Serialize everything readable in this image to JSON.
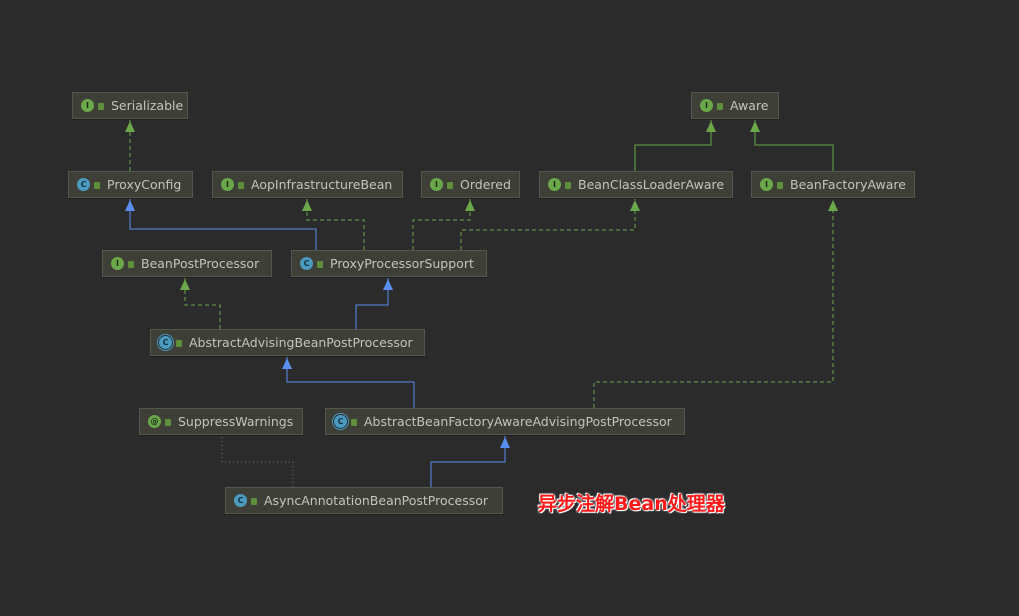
{
  "colors": {
    "background": "#2b2b2b",
    "inheritance": "#5a8ef0",
    "implements": "#6aa84a",
    "annotation": "#777777",
    "annotation_text": "#ff1a1a"
  },
  "nodes": {
    "serializable": {
      "label": "Serializable",
      "kind": "interface"
    },
    "aware": {
      "label": "Aware",
      "kind": "interface"
    },
    "proxy_config": {
      "label": "ProxyConfig",
      "kind": "class"
    },
    "aop_infrastructure_bean": {
      "label": "AopInfrastructureBean",
      "kind": "interface"
    },
    "ordered": {
      "label": "Ordered",
      "kind": "interface"
    },
    "bean_class_loader_aware": {
      "label": "BeanClassLoaderAware",
      "kind": "interface"
    },
    "bean_factory_aware": {
      "label": "BeanFactoryAware",
      "kind": "interface"
    },
    "bean_post_processor": {
      "label": "BeanPostProcessor",
      "kind": "interface"
    },
    "proxy_processor_support": {
      "label": "ProxyProcessorSupport",
      "kind": "class"
    },
    "abstract_advising_bpp": {
      "label": "AbstractAdvisingBeanPostProcessor",
      "kind": "abstract-class"
    },
    "suppress_warnings": {
      "label": "SuppressWarnings",
      "kind": "annotation"
    },
    "abstract_bfa_advising_pp": {
      "label": "AbstractBeanFactoryAwareAdvisingPostProcessor",
      "kind": "abstract-class"
    },
    "async_annotation_bpp": {
      "label": "AsyncAnnotationBeanPostProcessor",
      "kind": "class"
    }
  },
  "icon_letters": {
    "class": "C",
    "interface": "I",
    "annotation": "@"
  },
  "edges": [
    {
      "from": "proxy_config",
      "to": "serializable",
      "type": "implements"
    },
    {
      "from": "bean_class_loader_aware",
      "to": "aware",
      "type": "extends-interface"
    },
    {
      "from": "bean_factory_aware",
      "to": "aware",
      "type": "extends-interface"
    },
    {
      "from": "proxy_processor_support",
      "to": "proxy_config",
      "type": "extends"
    },
    {
      "from": "proxy_processor_support",
      "to": "aop_infrastructure_bean",
      "type": "implements"
    },
    {
      "from": "proxy_processor_support",
      "to": "ordered",
      "type": "implements"
    },
    {
      "from": "proxy_processor_support",
      "to": "bean_class_loader_aware",
      "type": "implements"
    },
    {
      "from": "abstract_advising_bpp",
      "to": "bean_post_processor",
      "type": "implements"
    },
    {
      "from": "abstract_advising_bpp",
      "to": "proxy_processor_support",
      "type": "extends"
    },
    {
      "from": "abstract_bfa_advising_pp",
      "to": "abstract_advising_bpp",
      "type": "extends"
    },
    {
      "from": "abstract_bfa_advising_pp",
      "to": "bean_factory_aware",
      "type": "implements"
    },
    {
      "from": "async_annotation_bpp",
      "to": "suppress_warnings",
      "type": "annotated"
    },
    {
      "from": "async_annotation_bpp",
      "to": "abstract_bfa_advising_pp",
      "type": "extends"
    }
  ],
  "annotation_note": "异步注解Bean处理器"
}
